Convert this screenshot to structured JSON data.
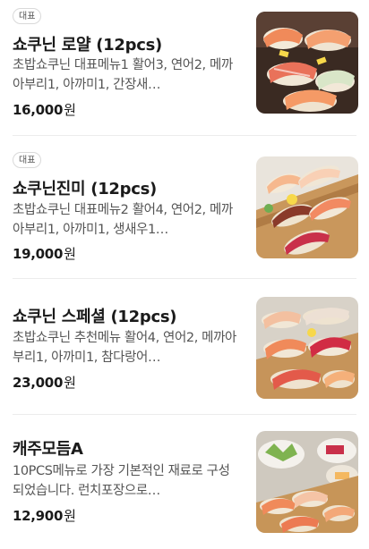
{
  "items": [
    {
      "badge": "대표",
      "name": "쇼쿠닌 로얄 (12pcs)",
      "description": "초밥쇼쿠닌 대표메뉴1 활어3, 연어2, 메까아부리1, 아까미1, 간장새…",
      "price": "16,000",
      "currency": "원",
      "image_icon": "sushi-platter-image"
    },
    {
      "badge": "대표",
      "name": "쇼쿠닌진미 (12pcs)",
      "description": "초밥쇼쿠닌 대표메뉴2 활어4, 연어2, 메까아부리1, 아까미1, 생새우1…",
      "price": "19,000",
      "currency": "원",
      "image_icon": "sushi-platter-image"
    },
    {
      "badge": "",
      "name": "쇼쿠닌 스페셜 (12pcs)",
      "description": "초밥쇼쿠닌 추천메뉴 활어4, 연어2, 메까아부리1, 아까미1, 참다랑어…",
      "price": "23,000",
      "currency": "원",
      "image_icon": "sushi-platter-image"
    },
    {
      "badge": "",
      "name": "캐주모듬A",
      "description": "10PCS메뉴로 가장 기본적인 재료로 구성되었습니다. 런치포장으로…",
      "price": "12,900",
      "currency": "원",
      "image_icon": "sushi-set-image"
    }
  ]
}
